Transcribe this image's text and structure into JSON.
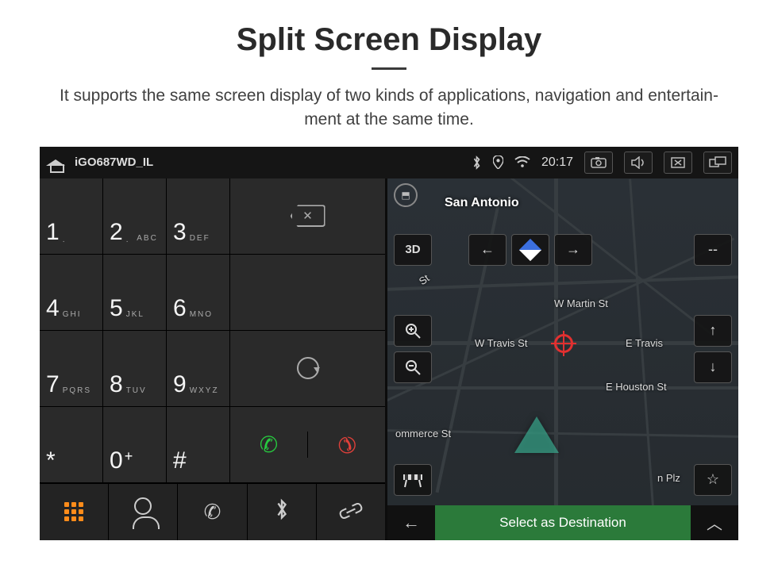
{
  "title": "Split Screen Display",
  "subtitle_l1": "It supports the same screen display of two kinds of applications, navigation and entertain-",
  "subtitle_l2": "ment at the same time.",
  "status": {
    "app_name": "iGO687WD_IL",
    "clock": "20:17",
    "icons": {
      "bluetooth": "bluetooth",
      "location": "location",
      "wifi": "wifi"
    },
    "sys": {
      "camera": "camera",
      "volume": "volume",
      "close": "close-box",
      "recents": "recents"
    }
  },
  "keypad": {
    "keys": [
      {
        "num": "1",
        "sub": "∞"
      },
      {
        "num": "2",
        "sub": "ABC"
      },
      {
        "num": "3",
        "sub": "DEF"
      },
      {
        "num": "4",
        "sub": "GHI"
      },
      {
        "num": "5",
        "sub": "JKL"
      },
      {
        "num": "6",
        "sub": "MNO"
      },
      {
        "num": "7",
        "sub": "PQRS"
      },
      {
        "num": "8",
        "sub": "TUV"
      },
      {
        "num": "9",
        "sub": "WXYZ"
      },
      {
        "num": "*",
        "sub": ""
      },
      {
        "num": "0",
        "sub": "+"
      },
      {
        "num": "#",
        "sub": ""
      }
    ],
    "side": {
      "backspace": "backspace",
      "empty": "",
      "cycle": "cycle"
    },
    "call": "call",
    "hangup": "hangup"
  },
  "tabs": {
    "apps": "apps",
    "contacts": "contacts",
    "phone": "phone",
    "bluetooth": "bluetooth",
    "link": "link"
  },
  "map": {
    "city": "San Antonio",
    "mode3d": "3D",
    "minus": "--",
    "streets": {
      "martin": "W Martin St",
      "travis": "W Travis St",
      "travis_e": "E Travis",
      "houston": "E Houston St",
      "commerce": "ommerce St",
      "plz": "n Plz",
      "st_top": "St"
    },
    "bottom": {
      "destination": "Select as Destination"
    }
  },
  "colors": {
    "accent_green": "#2b7a3a",
    "call_green": "#27c93f",
    "hangup_red": "#e0403a",
    "apps_orange": "#ff8c1a",
    "target_red": "#e23030"
  }
}
